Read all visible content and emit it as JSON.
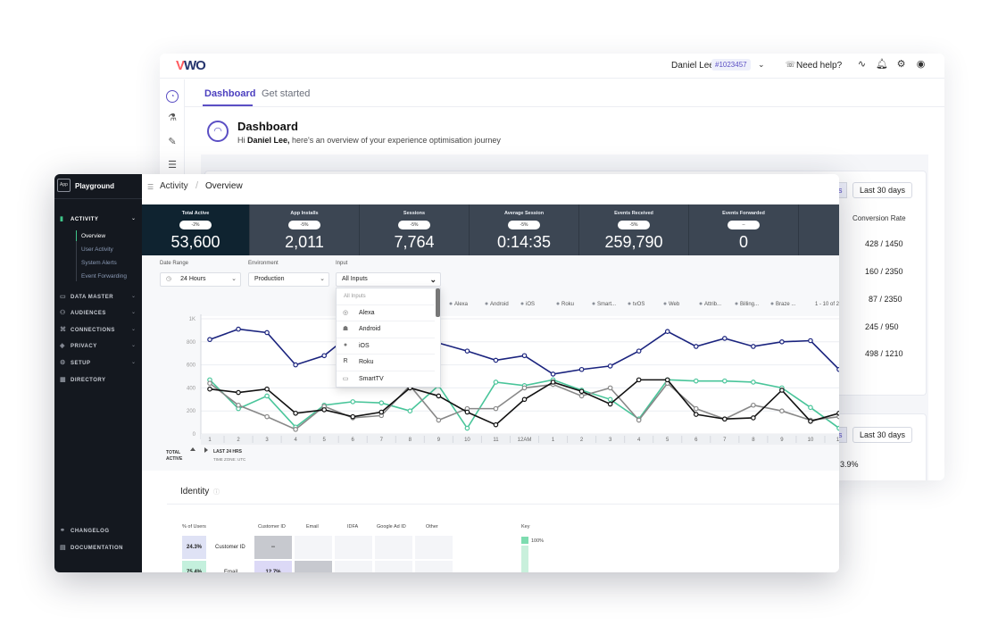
{
  "back": {
    "logo": "VWO",
    "user_name": "Daniel Lee",
    "account_id": "#1023457",
    "help_label": "Need help?",
    "tabs": [
      "Dashboard",
      "Get started"
    ],
    "title": "Dashboard",
    "subtitle_prefix": "Hi ",
    "subtitle_name": "Daniel Lee,",
    "subtitle_rest": " here's an overview of your experience optimisation journey",
    "pill_partial": "s",
    "pill_range": "Last 30 days",
    "conversion_header": "Conversion Rate",
    "conversion_values": [
      "428 / 1450",
      "160 / 2350",
      "87 / 2350",
      "245 / 950",
      "498 / 1210"
    ],
    "pill_partial_2": "s",
    "pill_range_2": "Last 30 days",
    "percent_value": "3.9%"
  },
  "sidebar": {
    "logo": "App",
    "title": "Playground",
    "sections": [
      {
        "label": "ACTIVITY",
        "icon": "bar-chart-icon"
      },
      {
        "label": "DATA MASTER",
        "icon": "table-icon"
      },
      {
        "label": "AUDIENCES",
        "icon": "users-icon"
      },
      {
        "label": "CONNECTIONS",
        "icon": "connections-icon"
      },
      {
        "label": "PRIVACY",
        "icon": "shield-icon"
      },
      {
        "label": "SETUP",
        "icon": "gear-icon"
      },
      {
        "label": "DIRECTORY",
        "icon": "grid-icon"
      }
    ],
    "activity_items": [
      "Overview",
      "User Activity",
      "System Alerts",
      "Event Forwarding"
    ],
    "footer": [
      {
        "label": "CHANGELOG",
        "icon": "link-icon"
      },
      {
        "label": "DOCUMENTATION",
        "icon": "doc-icon"
      }
    ]
  },
  "breadcrumb": {
    "parent": "Activity",
    "current": "Overview"
  },
  "stats": [
    {
      "label": "Total Active",
      "chip": "-2%",
      "value": "53,600"
    },
    {
      "label": "App Installs",
      "chip": "-5%",
      "value": "2,011"
    },
    {
      "label": "Sessions",
      "chip": "-5%",
      "value": "7,764"
    },
    {
      "label": "Average Session",
      "chip": "-5%",
      "value": "0:14:35"
    },
    {
      "label": "Events Received",
      "chip": "-5%",
      "value": "259,790"
    },
    {
      "label": "Events Forwarded",
      "chip": "--",
      "value": "0"
    }
  ],
  "filters": {
    "date_range_label": "Date Range",
    "date_range_value": "24 Hours",
    "environment_label": "Environment",
    "environment_value": "Production",
    "input_label": "Input",
    "input_value": "All Inputs"
  },
  "dropdown": {
    "header": "All Inputs",
    "items": [
      {
        "label": "Alexa",
        "icon": "alexa-icon"
      },
      {
        "label": "Android",
        "icon": "android-icon"
      },
      {
        "label": "iOS",
        "icon": "apple-icon"
      },
      {
        "label": "Roku",
        "icon": "roku-icon"
      },
      {
        "label": "SmartTV",
        "icon": "tv-icon"
      }
    ]
  },
  "chart_data": {
    "type": "line",
    "legend": [
      "Alexa",
      "Android",
      "iOS",
      "Roku",
      "Smart...",
      "tvOS",
      "Web",
      "Attrib...",
      "Billing...",
      "Braze ..."
    ],
    "legend_page": "1 - 10 of 2",
    "y_ticks": [
      "1K",
      "800",
      "600",
      "400",
      "200",
      "0"
    ],
    "ylim": [
      0,
      1000
    ],
    "x_ticks": [
      "1",
      "2",
      "3",
      "4",
      "5",
      "6",
      "7",
      "8",
      "9",
      "10",
      "11",
      "12AM",
      "1",
      "2",
      "3",
      "4",
      "5",
      "6",
      "7",
      "8",
      "9",
      "10",
      "11"
    ],
    "x_label_left": "TOTAL ACTIVE",
    "x_label_main": "LAST 24 HRS",
    "x_label_sub": "TIME ZONE: UTC",
    "series": [
      {
        "color": "#1a237e",
        "values": [
          820,
          910,
          880,
          600,
          680,
          880,
          870,
          880,
          790,
          720,
          640,
          680,
          520,
          560,
          590,
          720,
          890,
          760,
          830,
          760,
          800,
          810,
          560
        ]
      },
      {
        "color": "#49c59a",
        "values": [
          470,
          220,
          330,
          60,
          250,
          280,
          270,
          200,
          420,
          50,
          450,
          420,
          470,
          380,
          300,
          130,
          470,
          460,
          460,
          450,
          400,
          230,
          50
        ]
      },
      {
        "color": "#888888",
        "values": [
          440,
          250,
          150,
          40,
          240,
          140,
          160,
          420,
          120,
          220,
          220,
          400,
          430,
          330,
          400,
          120,
          440,
          220,
          130,
          250,
          200,
          120,
          150
        ]
      },
      {
        "color": "#111111",
        "values": [
          390,
          360,
          390,
          180,
          210,
          150,
          190,
          400,
          330,
          190,
          80,
          300,
          450,
          370,
          260,
          470,
          470,
          170,
          130,
          140,
          380,
          110,
          180
        ]
      }
    ]
  },
  "identity": {
    "title": "Identity",
    "headers": [
      "% of Users",
      "Customer ID",
      "Email",
      "IDFA",
      "Google Ad ID",
      "Other"
    ],
    "key_label": "Key",
    "key_value": "100%",
    "row1": {
      "pct": "24.3%",
      "label": "Customer ID",
      "first_cell": "--"
    },
    "row2": {
      "pct": "75.4%",
      "label": "Email",
      "first_cell": "12.7%"
    }
  }
}
